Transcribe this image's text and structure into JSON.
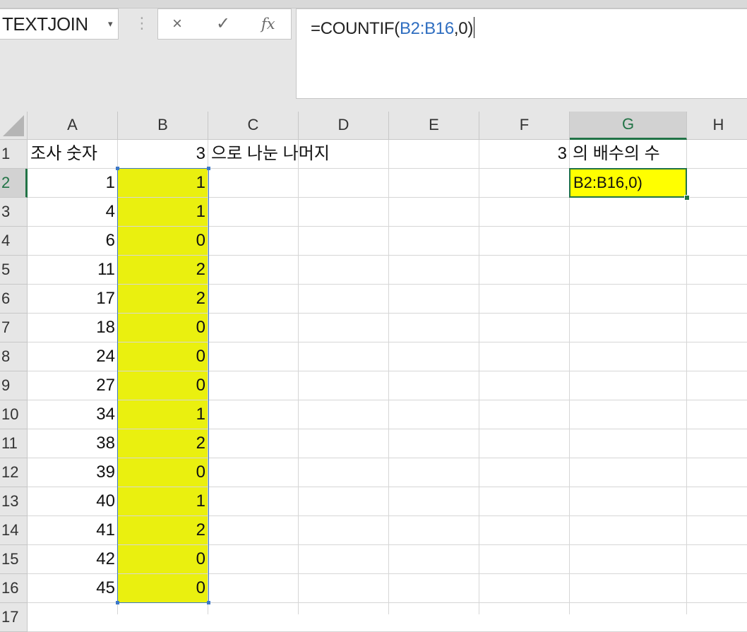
{
  "name_box": {
    "value": "TEXTJOIN"
  },
  "formula_bar": {
    "prefix": "=COUNTIF(",
    "range_ref": "B2:B16",
    "suffix": ",0)",
    "cancel_icon": "×",
    "enter_icon": "✓",
    "fx_label": "fx"
  },
  "columns": [
    "A",
    "B",
    "C",
    "D",
    "E",
    "F",
    "G",
    "H"
  ],
  "rows": [
    "1",
    "2",
    "3",
    "4",
    "5",
    "6",
    "7",
    "8",
    "9",
    "10",
    "11",
    "12",
    "13",
    "14",
    "15",
    "16",
    "17"
  ],
  "sheet": {
    "A1": "조사 숫자",
    "B1": "3",
    "C1": "으로 나눈 나머지",
    "F1": "3",
    "G1": "의 배수의 수",
    "G2_edit": "B2:B16,0)",
    "numbers_A": [
      "1",
      "4",
      "6",
      "11",
      "17",
      "18",
      "24",
      "27",
      "34",
      "38",
      "39",
      "40",
      "41",
      "42",
      "45"
    ],
    "remainders_B": [
      "1",
      "1",
      "0",
      "2",
      "2",
      "0",
      "0",
      "0",
      "1",
      "2",
      "0",
      "1",
      "2",
      "0",
      "0"
    ]
  },
  "colors": {
    "highlight_yellow": "#eaf00f",
    "active_cell_fill": "#ffff00",
    "selection_green": "#217346",
    "reference_blue": "#2f6ec0"
  }
}
